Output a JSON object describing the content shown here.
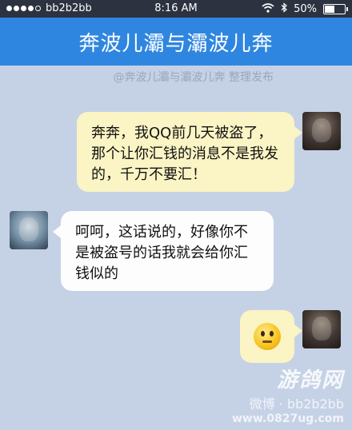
{
  "status_bar": {
    "carrier": "bb2b2bb",
    "time": "8:16 AM",
    "battery": "50%",
    "battery_level": 0.5,
    "signal_bars_filled": 4,
    "signal_bars_total": 5
  },
  "header": {
    "title": "奔波儿灞与灞波儿奔"
  },
  "credit": "@奔波儿灞与灞波儿奔 整理发布",
  "messages": [
    {
      "side": "right",
      "text": "奔奔，我QQ前几天被盗了，那个让你汇钱的消息不是我发的，千万不要汇！"
    },
    {
      "side": "left",
      "text": "呵呵，这话说的，好像你不是被盗号的话我就会给你汇钱似的"
    },
    {
      "side": "right",
      "emoji": "thinking-face"
    }
  ],
  "watermark": {
    "logo": "游鸽网",
    "weibo": "微博 · bb2b2bb",
    "site": "www.0827ug.com"
  },
  "colors": {
    "title_bar": "#2f86e0",
    "background": "#c5d2e6",
    "bubble_yellow": "#fbf4c4",
    "bubble_white": "#fdfdfd"
  }
}
